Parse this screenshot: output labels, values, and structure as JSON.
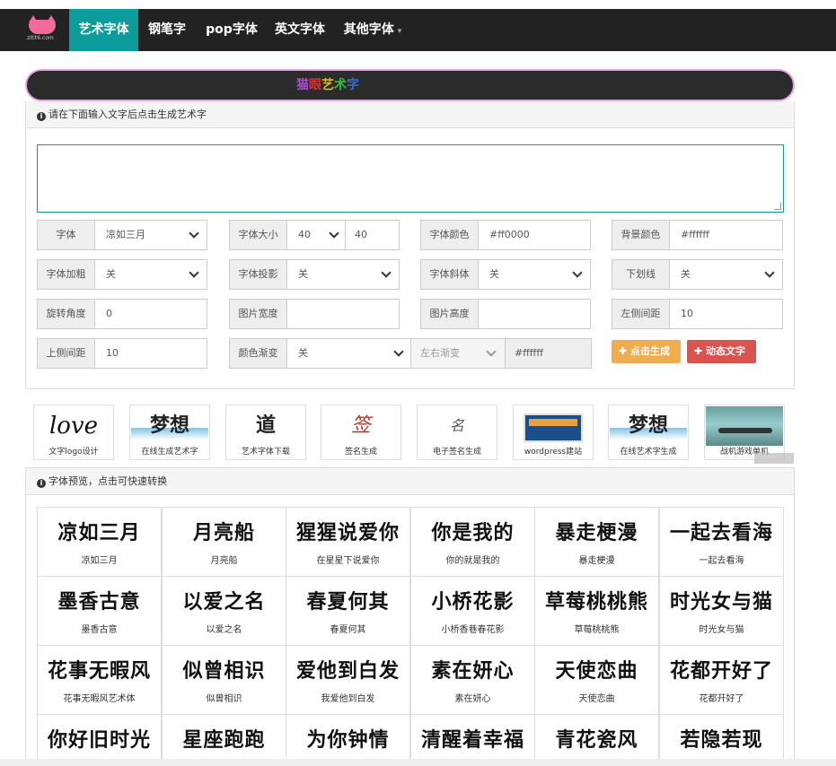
{
  "navbar": {
    "logo_text": "zitit6.com",
    "items": [
      {
        "label": "艺术字体"
      },
      {
        "label": "钢笔字"
      },
      {
        "label": "pop字体"
      },
      {
        "label": "英文字体"
      },
      {
        "label": "其他字体"
      }
    ],
    "active_color": "#0d9c9c"
  },
  "banner": {
    "text_parts": [
      "猫",
      "眼",
      "艺",
      "术",
      "字"
    ],
    "colors": [
      "#b048e0",
      "#e03030",
      "#e0c020",
      "#30c040",
      "#3070e0"
    ]
  },
  "form": {
    "header": "请在下面输入文字后点击生成艺术字",
    "textarea_value": "",
    "fields": {
      "font": {
        "label": "字体",
        "value": "凉如三月"
      },
      "size": {
        "label": "字体大小",
        "select": "40",
        "value": "40"
      },
      "color": {
        "label": "字体颜色",
        "value": "#ff0000"
      },
      "bgcolor": {
        "label": "背景颜色",
        "value": "#ffffff"
      },
      "bold": {
        "label": "字体加粗",
        "value": "关"
      },
      "shadow": {
        "label": "字体投影",
        "value": "关"
      },
      "italic": {
        "label": "字体斜体",
        "value": "关"
      },
      "underline": {
        "label": "下划线",
        "value": "关"
      },
      "rotate": {
        "label": "旋转角度",
        "value": "0"
      },
      "imgwidth": {
        "label": "图片宽度",
        "value": ""
      },
      "imgheight": {
        "label": "图片高度",
        "value": ""
      },
      "leftmargin": {
        "label": "左侧间距",
        "value": "10"
      },
      "topmargin": {
        "label": "上侧间距",
        "value": "10"
      },
      "gradient": {
        "label": "颜色渐变",
        "value": "关",
        "direction": "左右渐变",
        "gradient_color": "#ffffff"
      }
    },
    "generate_button": "点击生成",
    "animate_button": "动态文字"
  },
  "thumbs": [
    {
      "caption": "文字logo设计",
      "art": "love"
    },
    {
      "caption": "在线生成艺术字",
      "art": "梦想"
    },
    {
      "caption": "艺术字体下载",
      "art": "道"
    },
    {
      "caption": "签名生成",
      "art": "签"
    },
    {
      "caption": "电子签名生成",
      "art": "名"
    },
    {
      "caption": "wordpress建站",
      "art": ""
    },
    {
      "caption": "在线艺术字生成",
      "art": "梦想"
    },
    {
      "caption": "战机游戏单机",
      "art": ""
    }
  ],
  "preview": {
    "header": "字体预览，点击可快速转换",
    "fonts": [
      {
        "art": "凉如三月",
        "name": "凉如三月"
      },
      {
        "art": "月亮船",
        "name": "月亮船"
      },
      {
        "art": "猩猩说爱你",
        "name": "在星星下说爱你"
      },
      {
        "art": "你是我的",
        "name": "你的就是我的"
      },
      {
        "art": "暴走梗漫",
        "name": "暴走梗漫"
      },
      {
        "art": "一起去看海",
        "name": "一起去看海"
      },
      {
        "art": "墨香古意",
        "name": "墨香古意"
      },
      {
        "art": "以爱之名",
        "name": "以爱之名"
      },
      {
        "art": "春夏何其",
        "name": "春夏何其"
      },
      {
        "art": "小桥花影",
        "name": "小桥香巷春花影"
      },
      {
        "art": "草莓桃桃熊",
        "name": "草莓桃桃熊"
      },
      {
        "art": "时光女与猫",
        "name": "时光女与猫"
      },
      {
        "art": "花事无暇风",
        "name": "花事无暇风艺术体"
      },
      {
        "art": "似曾相识",
        "name": "似曾相识"
      },
      {
        "art": "爱他到白发",
        "name": "我爱他到白发"
      },
      {
        "art": "素在妍心",
        "name": "素在妍心"
      },
      {
        "art": "天使恋曲",
        "name": "天使恋曲"
      },
      {
        "art": "花都开好了",
        "name": "花都开好了"
      },
      {
        "art": "你好旧时光",
        "name": ""
      },
      {
        "art": "星座跑跑",
        "name": ""
      },
      {
        "art": "为你钟情",
        "name": ""
      },
      {
        "art": "清醒着幸福",
        "name": ""
      },
      {
        "art": "青花瓷风",
        "name": ""
      },
      {
        "art": "若隐若现",
        "name": ""
      }
    ]
  }
}
